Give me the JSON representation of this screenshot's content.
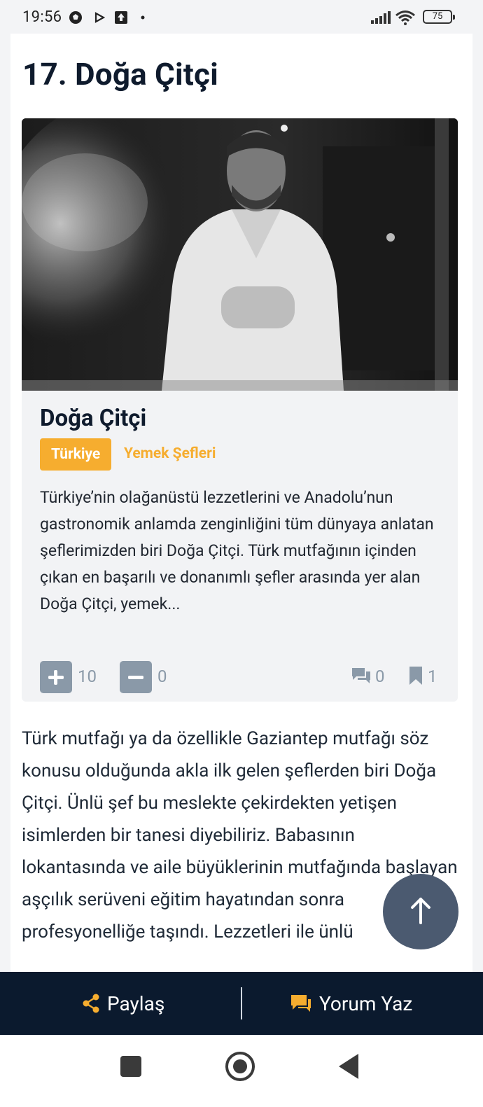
{
  "status_bar": {
    "time": "19:56",
    "battery": "75",
    "icons": [
      "soccer-ball-icon",
      "play-icon",
      "upload-icon",
      "dot-icon",
      "signal-icon",
      "wifi-icon",
      "battery-icon"
    ]
  },
  "article": {
    "heading": "17. Doğa Çitçi",
    "card": {
      "name": "Doğa Çitçi",
      "country_badge": "Türkiye",
      "category": "Yemek Şefleri",
      "summary": "Türkiye’nin olağanüstü lezzetlerini ve Anadolu’nun gastronomik anlamda zenginliğini tüm dünyaya anlatan şeflerimizden biri Doğa Çitçi. Türk mutfağının içinden çıkan en başarılı ve donanımlı şefler arasında yer alan Doğa Çitçi, yemek...",
      "upvotes": "10",
      "downvotes": "0",
      "comments": "0",
      "bookmarks": "1"
    },
    "body": "Türk mutfağı ya da özellikle Gaziantep mutfağı söz konusu olduğunda akla ilk gelen şeflerden biri Doğa Çitçi. Ünlü şef bu meslekte çekirdekten yetişen isimlerden bir tanesi diyebiliriz. Babasının lokantasında ve aile büyüklerinin mutfağında başlayan aşçılık serüveni eğitim hayatından sonra profesyonelliğe taşındı. Lezzetleri ile ünlü"
  },
  "action_bar": {
    "share_label": "Paylaş",
    "comment_label": "Yorum Yaz"
  },
  "colors": {
    "accent": "#f6ad2f",
    "navy": "#0b1a2e",
    "muted": "#8a99a8"
  }
}
